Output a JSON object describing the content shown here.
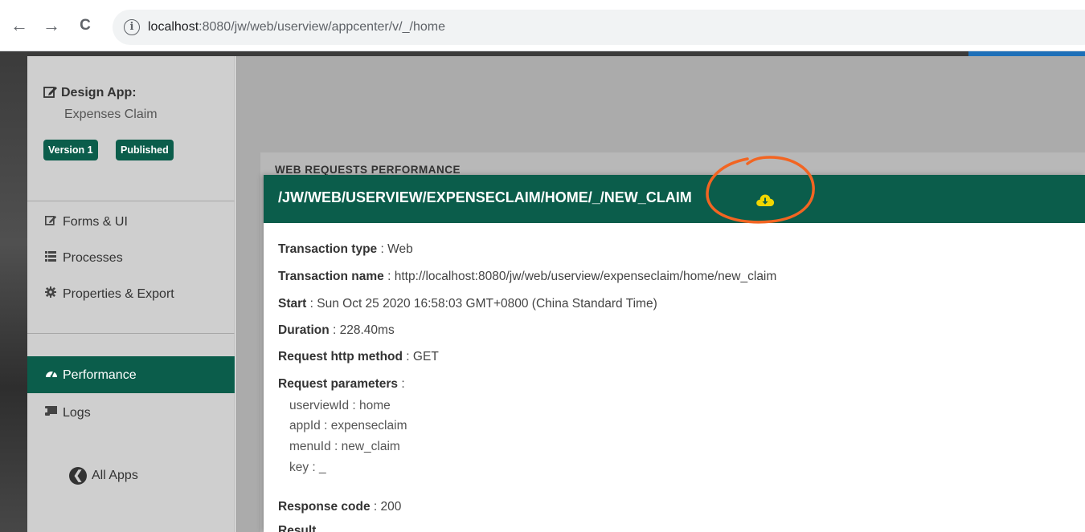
{
  "browser": {
    "back_glyph": "←",
    "forward_glyph": "→",
    "reload_glyph": "C",
    "info_glyph": "i",
    "url_host": "localhost",
    "url_path": ":8080/jw/web/userview/appcenter/v/_/home"
  },
  "sidebar": {
    "design_title": "Design App:",
    "design_sub": "Expenses Claim",
    "version_badge": "Version 1",
    "published_badge": "Published",
    "menu": [
      {
        "label": "Forms & UI",
        "icon": "edit-icon"
      },
      {
        "label": "Processes",
        "icon": "list-icon"
      },
      {
        "label": "Properties & Export",
        "icon": "cog-icon"
      },
      {
        "label": "Performance",
        "icon": "gauge-icon",
        "active": true
      },
      {
        "label": "Logs",
        "icon": "scroll-icon"
      }
    ],
    "all_apps": "All Apps"
  },
  "panel": {
    "title": "WEB REQUESTS PERFORMANCE"
  },
  "modal": {
    "title": "/JW/WEB/USERVIEW/EXPENSECLAIM/HOME/_/NEW_CLAIM",
    "fields": [
      {
        "key": "Transaction type",
        "value": " : Web"
      },
      {
        "key": "Transaction name",
        "value": " : http://localhost:8080/jw/web/userview/expenseclaim/home/new_claim"
      },
      {
        "key": "Start",
        "value": " : Sun Oct 25 2020 16:58:03 GMT+0800 (China Standard Time)"
      },
      {
        "key": "Duration",
        "value": " : 228.40ms"
      },
      {
        "key": "Request http method",
        "value": " : GET"
      },
      {
        "key": "Request parameters",
        "value": " :"
      }
    ],
    "params": [
      "userviewId : home",
      "appId : expenseclaim",
      "menuId : new_claim",
      "key : _"
    ],
    "response_key": "Response code",
    "response_value": " : 200",
    "cut_row": "Result"
  },
  "colors": {
    "brand_green": "#0b5d4b",
    "annotation_orange": "#f26522",
    "download_yellow": "#f2d600"
  }
}
